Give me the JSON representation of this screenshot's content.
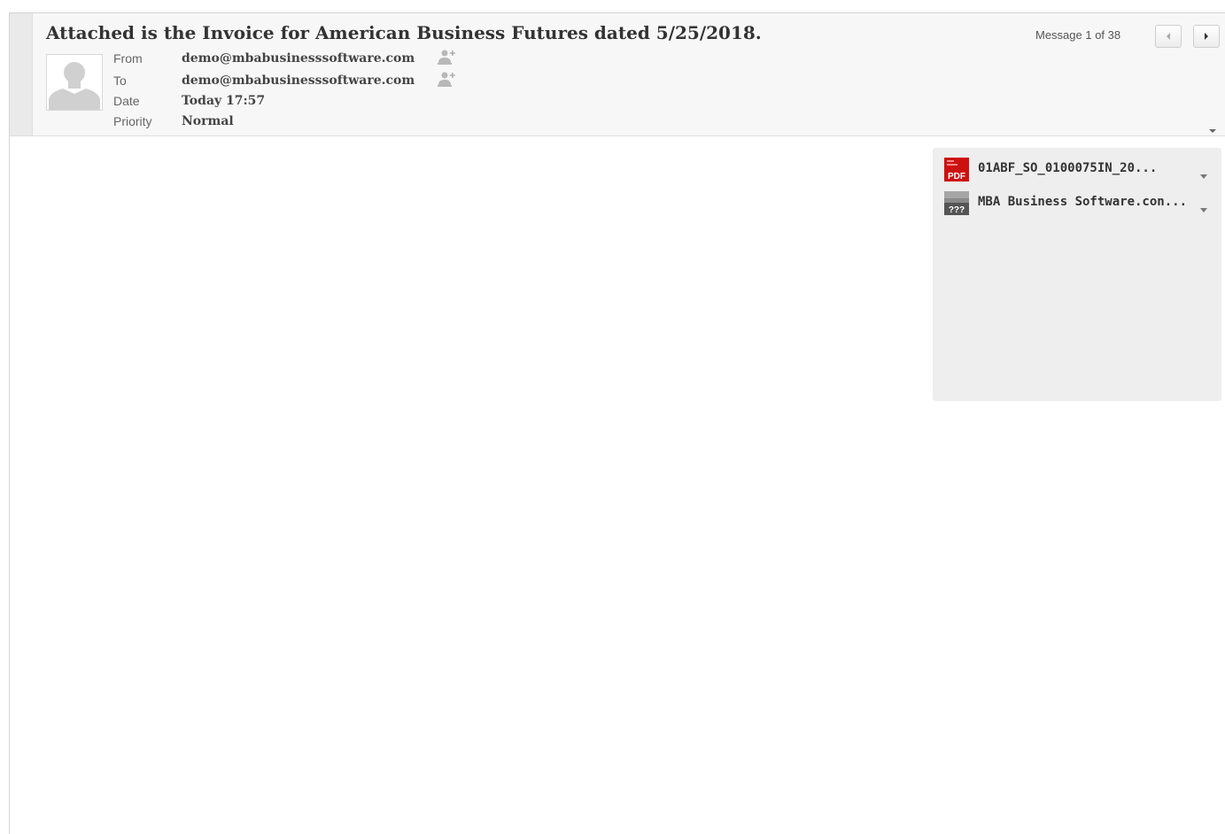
{
  "message": {
    "subject": "Attached is the Invoice for American Business Futures dated 5/25/2018.",
    "fields": [
      {
        "label": "From",
        "value": "demo@mbabusinesssoftware.com"
      },
      {
        "label": "To",
        "value": "demo@mbabusinesssoftware.com"
      },
      {
        "label": "Date",
        "value": "Today 17:57"
      },
      {
        "label": "Priority",
        "value": "Normal"
      }
    ],
    "counter": "Message 1 of 38"
  },
  "attachments": [
    {
      "name": "01ABF_SO_0100075IN_20...",
      "icon": "pdf-icon",
      "icon_text": "PDF"
    },
    {
      "name": "MBA Business Software.con...",
      "icon": "unknown-file-icon",
      "icon_text": "???"
    }
  ],
  "colors": {
    "pdf": "#cc1111",
    "unknown": "#8a8a8a",
    "header_bg": "#f7f7f7",
    "panel_bg": "#eeeeee"
  }
}
